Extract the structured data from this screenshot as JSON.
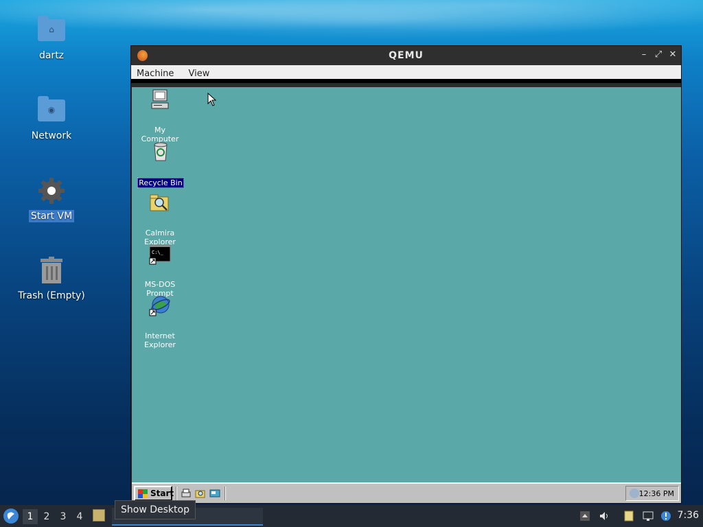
{
  "host_desktop": {
    "icons": [
      {
        "label": "dartz",
        "icon": "home-folder-icon",
        "selected": false
      },
      {
        "label": "Network",
        "icon": "network-folder-icon",
        "selected": false
      },
      {
        "label": "Start VM",
        "icon": "gear-icon",
        "selected": true
      },
      {
        "label": "Trash (Empty)",
        "icon": "trash-icon",
        "selected": false
      }
    ]
  },
  "qemu_window": {
    "title": "QEMU",
    "menu": [
      "Machine",
      "View"
    ],
    "controls": [
      "minimize",
      "maximize",
      "close"
    ]
  },
  "guest": {
    "icons": [
      {
        "label_lines": [
          "My Computer"
        ],
        "icon": "my-computer-icon",
        "selected": false
      },
      {
        "label_lines": [
          "Recycle Bin"
        ],
        "icon": "recycle-bin-icon",
        "selected": true
      },
      {
        "label_lines": [
          "Calmira",
          "Explorer"
        ],
        "icon": "calmira-explorer-icon",
        "selected": false
      },
      {
        "label_lines": [
          "MS-DOS",
          "Prompt"
        ],
        "icon": "msdos-prompt-icon",
        "selected": false
      },
      {
        "label_lines": [
          "Internet",
          "Explorer"
        ],
        "icon": "internet-explorer-icon",
        "selected": false
      }
    ],
    "taskbar": {
      "start_label": "Start",
      "clock": "12:36 PM"
    }
  },
  "panel": {
    "workspaces": [
      "1",
      "2",
      "3",
      "4"
    ],
    "active_workspace": "1",
    "tooltip": "Show Desktop",
    "clock": "7:36"
  },
  "colors": {
    "guest_desktop": "#5ba8a8",
    "panel": "#232a33",
    "accent": "#3c86d6"
  }
}
